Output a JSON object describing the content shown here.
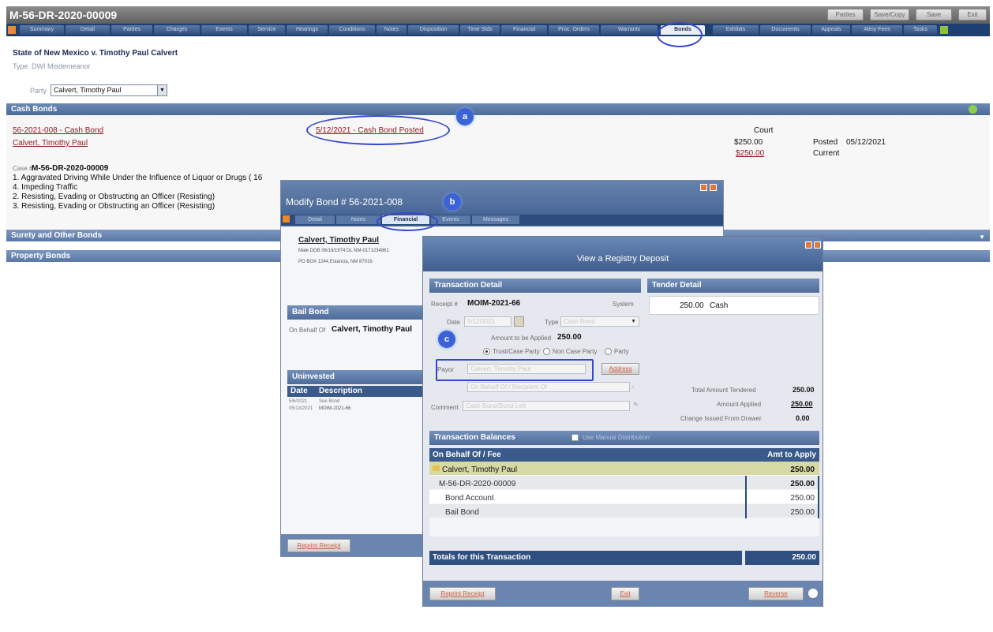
{
  "window": {
    "title": "M-56-DR-2020-00009",
    "buttons": [
      "Parties",
      "Save/Copy",
      "Save",
      "Exit"
    ]
  },
  "tabs": [
    "Summary",
    "Detail",
    "Parties",
    "Charges",
    "Events",
    "Service",
    "Hearings",
    "Conditions",
    "Notes",
    "Disposition",
    "Time Stds",
    "Financial",
    "Proc. Orders",
    "Warrants",
    "Bonds",
    "Exhibits",
    "Documents",
    "Appeals",
    "Attny Fees",
    "Tasks"
  ],
  "active_tab": "Bonds",
  "case": {
    "caption": "State of New Mexico v. Timothy Paul Calvert",
    "type_label": "Type",
    "type_value": "DWI Misdemeanor",
    "party_label": "Party",
    "party_value": "Calvert, Timothy Paul"
  },
  "cash_bonds": {
    "header": "Cash Bonds",
    "bond_link": "56-2021-008 - Cash Bond",
    "party_link": "Calvert, Timothy Paul",
    "posted_link": "5/12/2021 - Cash Bond Posted",
    "court": "Court",
    "amount1": "$250.00",
    "amount2": "$250.00",
    "posted_label": "Posted",
    "posted_date": "05/12/2021",
    "current_label": "Current",
    "case_label": "Case #",
    "case_number": "M-56-DR-2020-00009",
    "charges": [
      "1. Aggravated Driving While Under the Influence of Liquor or Drugs ( 16",
      "4. Impeding Traffic",
      "2. Resisting, Evading or Obstructing an Officer (Resisting)",
      "3. Resisting, Evading or Obstructing an Officer (Resisting)"
    ]
  },
  "surety_header": "Surety and Other Bonds",
  "property_header": "Property Bonds",
  "callouts": {
    "a": "a",
    "b": "b",
    "c": "c"
  },
  "modify_dialog": {
    "title": "Modify Bond # 56-2021-008",
    "subtabs": [
      "Detail",
      "Notes",
      "Financial",
      "Events",
      "Messages"
    ],
    "active_subtab": "Financial",
    "party_name": "Calvert, Timothy Paul",
    "party_line1": "Male  DOB 06/16/1974  DL NM-0171234861",
    "party_line2": "PO BOX 1244,Estancia, NM 87016",
    "bail_bond_header": "Bail Bond",
    "on_behalf_label": "On Behalf Of",
    "on_behalf_value": "Calvert, Timothy Paul",
    "uninvested_header": "Uninvested",
    "col_date": "Date",
    "col_description": "Description",
    "row_date1": "5/6/2021",
    "row_date2": "05/13/2021",
    "row_desc1": "See Bond",
    "row_desc2": "MOIM-2021-66",
    "reprint_button": "Reprint Receipt"
  },
  "registry_dialog": {
    "title": "View a Registry Deposit",
    "transaction_detail": "Transaction Detail",
    "tender_detail": "Tender Detail",
    "receipt_label": "Receipt #",
    "receipt_value": "MOIM-2021-66",
    "system_label": "System",
    "date_label": "Date",
    "date_value": "5/12/2021",
    "type_label": "Type",
    "type_value": "Cash Bond",
    "amount_label": "Amount to be Applied",
    "amount_value": "250.00",
    "radio_options": [
      "Trust/Case Party",
      "Non Case Party",
      "Party"
    ],
    "payor_label": "Payor",
    "payor_value": "Calvert, Timothy Paul",
    "address_button": "Address",
    "behalf_placeholder": "On Behalf Of / Recipient Of",
    "comment_label": "Comment",
    "comment_value": "Cash Bond/Bond Left",
    "tender_amount": "250.00",
    "tender_type": "Cash",
    "total_tendered_label": "Total Amount Tendered",
    "total_tendered_value": "250.00",
    "amount_applied_label": "Amount Applied",
    "amount_applied_value": "250.00",
    "change_label": "Change Issued From Drawer",
    "change_value": "0.00",
    "balances_header": "Transaction Balances",
    "manual_dist_label": "Use Manual Distribution",
    "col_behalf": "On Behalf Of / Fee",
    "col_amt": "Amt to Apply",
    "rows": [
      {
        "label": "Calvert, Timothy Paul",
        "amount": "250.00"
      },
      {
        "label": "M-56-DR-2020-00009",
        "amount": "250.00"
      },
      {
        "label": "Bond Account",
        "amount": "250.00"
      },
      {
        "label": "Bail Bond",
        "amount": "250.00"
      }
    ],
    "totals_label": "Totals for this Transaction",
    "totals_value": "250.00",
    "reprint_button": "Reprint Receipt",
    "exit_button": "Exit",
    "reverse_button": "Reverse"
  }
}
